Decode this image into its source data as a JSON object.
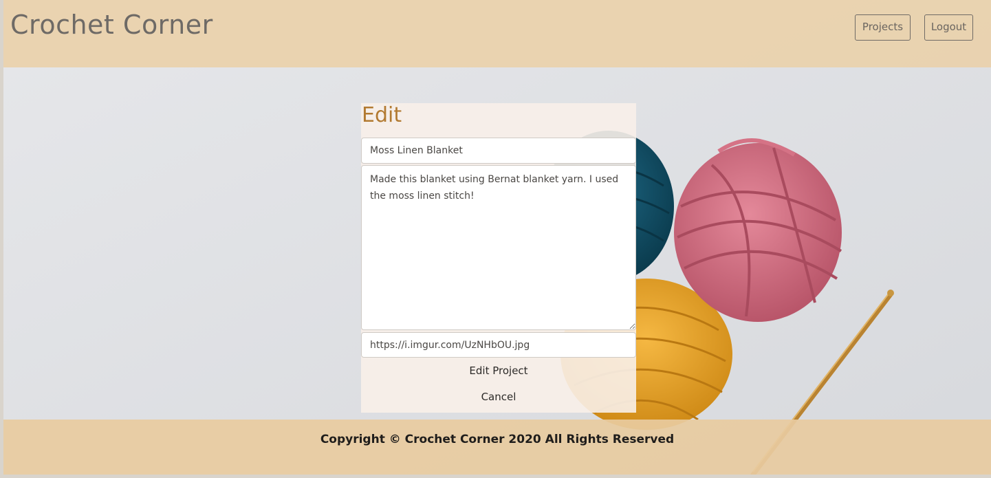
{
  "header": {
    "brand": "Crochet Corner",
    "nav": {
      "projects_label": "Projects",
      "logout_label": "Logout"
    }
  },
  "form": {
    "title": "Edit",
    "name_value": "Moss Linen Blanket",
    "description_value": "Made this blanket using Bernat blanket yarn. I used the moss linen stitch!",
    "image_url_value": "https://i.imgur.com/UzNHbOU.jpg",
    "submit_label": "Edit Project",
    "cancel_label": "Cancel"
  },
  "footer": {
    "copyright": "Copyright © Crochet Corner 2020 All Rights Reserved"
  },
  "colors": {
    "header_bg": "#eacfa9",
    "footer_bg": "#e8cba0",
    "title_accent": "#b27a31",
    "yarn_blue": "#0f4d64",
    "yarn_pink": "#cf6b7e",
    "yarn_yellow": "#e8a42a",
    "hook_gold": "#c08a3a"
  }
}
